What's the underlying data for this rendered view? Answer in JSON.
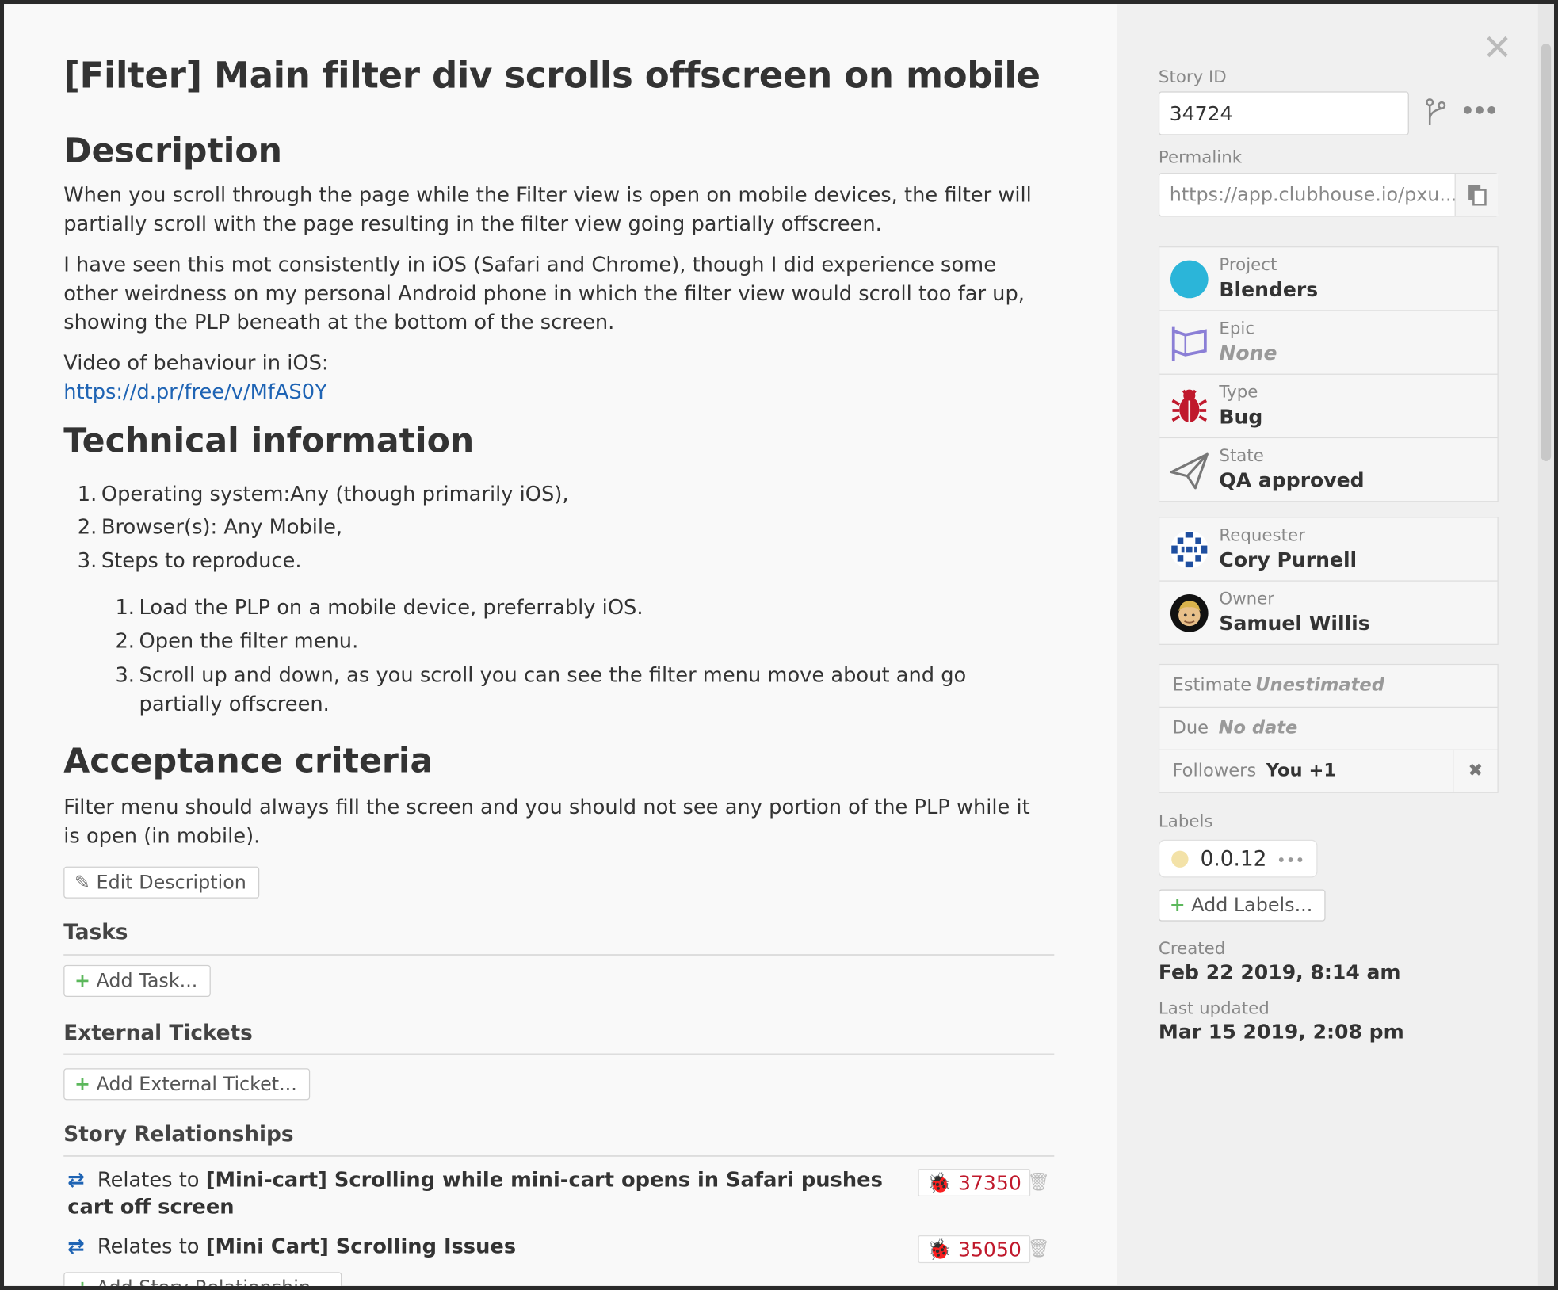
{
  "title": "[Filter] Main filter div scrolls offscreen on mobile",
  "description": {
    "heading": "Description",
    "para1": "When you scroll through the page while the Filter view is open on mobile devices, the filter will partially scroll with the page resulting in the filter view going partially offscreen.",
    "para2": "I have seen this mot consistently in iOS (Safari and Chrome), though I did experience some other weirdness on my personal Android phone in which the filter view would scroll too far up, showing the PLP beneath at the bottom of the screen.",
    "video_label": "Video of behaviour in iOS:",
    "video_link": "https://d.pr/free/v/MfAS0Y"
  },
  "technical": {
    "heading": "Technical information",
    "items": [
      {
        "num": "1.",
        "text": "Operating system:Any (though primarily iOS),"
      },
      {
        "num": "2.",
        "text": "Browser(s): Any Mobile,"
      },
      {
        "num": "3.",
        "text": "Steps to reproduce."
      }
    ],
    "steps": [
      {
        "num": "1.",
        "text": "Load the PLP on a mobile device, preferrably iOS."
      },
      {
        "num": "2.",
        "text": "Open the filter menu."
      },
      {
        "num": "3.",
        "text": "Scroll up and down, as you scroll you can see the filter menu move about and go",
        "text2": "partially offscreen."
      }
    ]
  },
  "acceptance": {
    "heading": "Acceptance criteria",
    "text": "Filter menu should always fill the screen and you should not see any portion of the PLP while it is open (in mobile)."
  },
  "buttons": {
    "edit_description": "Edit Description",
    "add_task": "Add Task...",
    "add_external": "Add External Ticket...",
    "add_relationship": "Add Story Relationship..."
  },
  "sections": {
    "tasks": "Tasks",
    "external": "External Tickets",
    "relationships": "Story Relationships"
  },
  "relationships": [
    {
      "prefix": "Relates to",
      "name": "[Mini-cart] Scrolling while mini-cart opens in Safari pushes cart off screen",
      "id": "37350"
    },
    {
      "prefix": "Relates to",
      "name": "[Mini Cart] Scrolling Issues",
      "id": "35050"
    }
  ],
  "sidebar": {
    "story_id_label": "Story ID",
    "story_id": "34724",
    "permalink_label": "Permalink",
    "permalink": "https://app.clubhouse.io/pxu...",
    "project_label": "Project",
    "project": "Blenders",
    "epic_label": "Epic",
    "epic": "None",
    "type_label": "Type",
    "type": "Bug",
    "state_label": "State",
    "state": "QA approved",
    "requester_label": "Requester",
    "requester": "Cory Purnell",
    "owner_label": "Owner",
    "owner": "Samuel Willis",
    "estimate_label": "Estimate",
    "estimate": "Unestimated",
    "due_label": "Due",
    "due": "No date",
    "followers_label": "Followers",
    "followers": "You +1",
    "labels_label": "Labels",
    "label_chip": "0.0.12",
    "add_labels": "Add Labels...",
    "created_label": "Created",
    "created": "Feb 22 2019, 8:14 am",
    "updated_label": "Last updated",
    "updated": "Mar 15 2019, 2:08 pm"
  },
  "colors": {
    "link": "#1f64b4",
    "bug_red": "#c0192c",
    "project_blue": "#2bb5d9",
    "epic_purple": "#8b7fd6",
    "add_green": "#5cb85c"
  },
  "icons": {
    "close": "close-icon",
    "branch": "git-branch-icon",
    "more": "ellipsis-icon",
    "copy": "clipboard-icon",
    "project": "project-dot-icon",
    "epic": "flag-icon",
    "type": "bug-icon",
    "state": "paper-plane-icon",
    "requester": "avatar-pattern",
    "owner": "avatar-photo",
    "trash": "trash-icon",
    "relates": "two-way-arrow-icon"
  }
}
